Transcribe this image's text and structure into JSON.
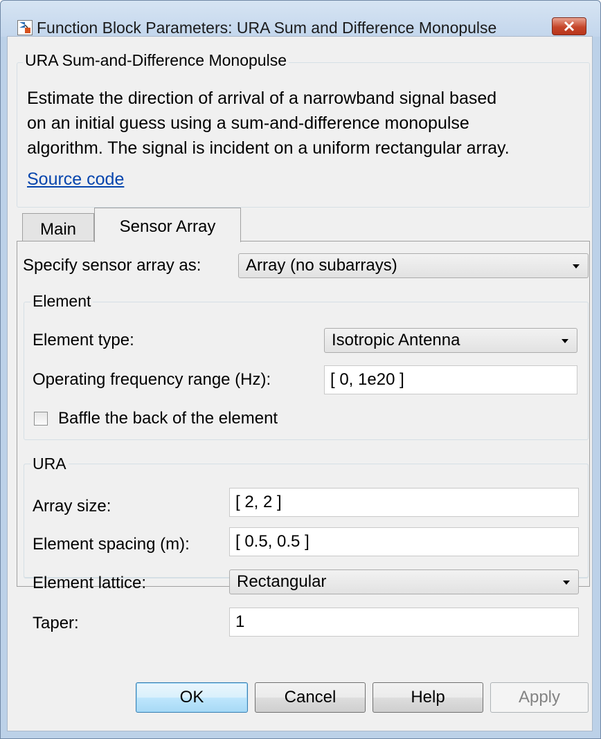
{
  "window": {
    "title": "Function Block Parameters: URA Sum and Difference Monopulse"
  },
  "block": {
    "group_title": "URA Sum-and-Difference Monopulse",
    "description_lines": [
      "Estimate the direction of arrival of a narrowband signal based",
      "on an initial guess using a sum-and-difference monopulse",
      "algorithm. The signal is incident on a uniform rectangular array."
    ],
    "source_link": "Source code"
  },
  "tabs": [
    {
      "label": "Main",
      "active": false
    },
    {
      "label": "Sensor Array",
      "active": true
    }
  ],
  "sensor_array": {
    "specify_label": "Specify sensor array as:",
    "specify_value": "Array (no subarrays)",
    "element": {
      "legend": "Element",
      "type_label": "Element type:",
      "type_value": "Isotropic Antenna",
      "freq_label": "Operating frequency range (Hz):",
      "freq_value": "[ 0, 1e20 ]",
      "baffle_label": "Baffle the back of the element",
      "baffle_checked": false
    },
    "ura": {
      "legend": "URA",
      "size_label": "Array size:",
      "size_value": "[ 2, 2 ]",
      "spacing_label": "Element spacing (m):",
      "spacing_value": "[ 0.5, 0.5 ]",
      "lattice_label": "Element lattice:",
      "lattice_value": "Rectangular",
      "taper_label": "Taper:",
      "taper_value": "1"
    }
  },
  "buttons": {
    "ok": "OK",
    "cancel": "Cancel",
    "help": "Help",
    "apply": "Apply"
  },
  "colors": {
    "titlebar": "#c3d6ec",
    "close_button": "#c6462a",
    "link": "#0645ad",
    "default_button": "#bee6fd"
  }
}
